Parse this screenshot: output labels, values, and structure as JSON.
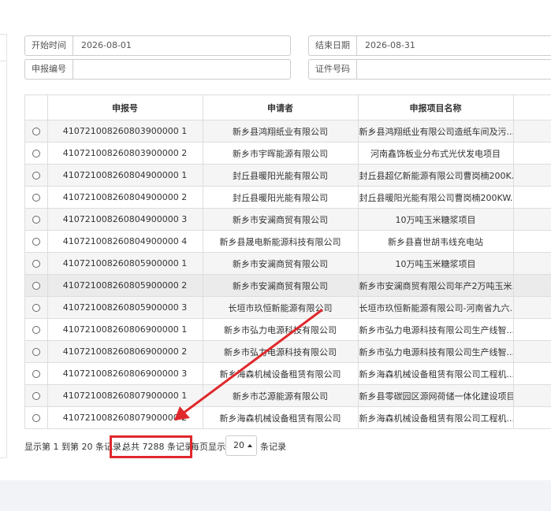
{
  "filters": {
    "start_time": {
      "label": "开始时间",
      "value": "2026-08-01"
    },
    "end_date": {
      "label": "结束日期",
      "value": "2026-08-31"
    },
    "application_no": {
      "label": "申报编号",
      "value": ""
    },
    "certificate_no": {
      "label": "证件号码",
      "value": ""
    }
  },
  "table": {
    "columns": [
      "申报号",
      "申请者",
      "申报项目名称"
    ],
    "rows": [
      {
        "no": "410721008260803900000 1",
        "applicant": "新乡县鸿翔纸业有限公司",
        "project": "新乡县鸿翔纸业有限公司造纸车间及污..."
      },
      {
        "no": "410721008260803900000 2",
        "applicant": "新乡市宇晖能源有限公司",
        "project": "河南鑫饰板业分布式光伏发电项目"
      },
      {
        "no": "410721008260804900000 1",
        "applicant": "封丘县暖阳光能有限公司",
        "project": "封丘县超亿新能源有限公司曹岗楠200K..."
      },
      {
        "no": "410721008260804900000 2",
        "applicant": "封丘县暖阳光能有限公司",
        "project": "封丘县暖阳光能有限公司曹岗楠200KW..."
      },
      {
        "no": "410721008260804900000 3",
        "applicant": "新乡市安澜商贸有限公司",
        "project": "10万吨玉米糖浆项目"
      },
      {
        "no": "410721008260804900000 4",
        "applicant": "新乡县晟电新能源科技有限公司",
        "project": "新乡县喜世胡韦线充电站"
      },
      {
        "no": "410721008260805900000 1",
        "applicant": "新乡市安澜商贸有限公司",
        "project": "10万吨玉米糖浆项目"
      },
      {
        "no": "410721008260805900000 2",
        "applicant": "新乡市安澜商贸有限公司",
        "project": "新乡市安澜商贸有限公司年产2万吨玉米..."
      },
      {
        "no": "410721008260805900000 3",
        "applicant": "长垣市玖恒新能源有限公司",
        "project": "长垣市玖恒新能源有限公司-河南省九六..."
      },
      {
        "no": "410721008260806900000 1",
        "applicant": "新乡市弘力电源科技有限公司",
        "project": "新乡市弘力电源科技有限公司生产线智..."
      },
      {
        "no": "410721008260806900000 2",
        "applicant": "新乡市弘力电源科技有限公司",
        "project": "新乡市弘力电源科技有限公司生产线智..."
      },
      {
        "no": "410721008260806900000 3",
        "applicant": "新乡海森机械设备租赁有限公司",
        "project": "新乡海森机械设备租赁有限公司工程机..."
      },
      {
        "no": "410721008260807900000 1",
        "applicant": "新乡市芯源能源有限公司",
        "project": "新乡县零碳园区源网荷储一体化建设项目"
      },
      {
        "no": "410721008260807900000 2",
        "applicant": "新乡海森机械设备租赁有限公司",
        "project": "新乡海森机械设备租赁有限公司工程机..."
      }
    ]
  },
  "pagination": {
    "range_text": "显示第 1 到第 20 条记录，",
    "total_text": "总共 7288 条记录",
    "per_page_prefix": "每页显示",
    "page_size": "20",
    "per_page_suffix": "条记录"
  },
  "annotation_color": "#e0282c"
}
